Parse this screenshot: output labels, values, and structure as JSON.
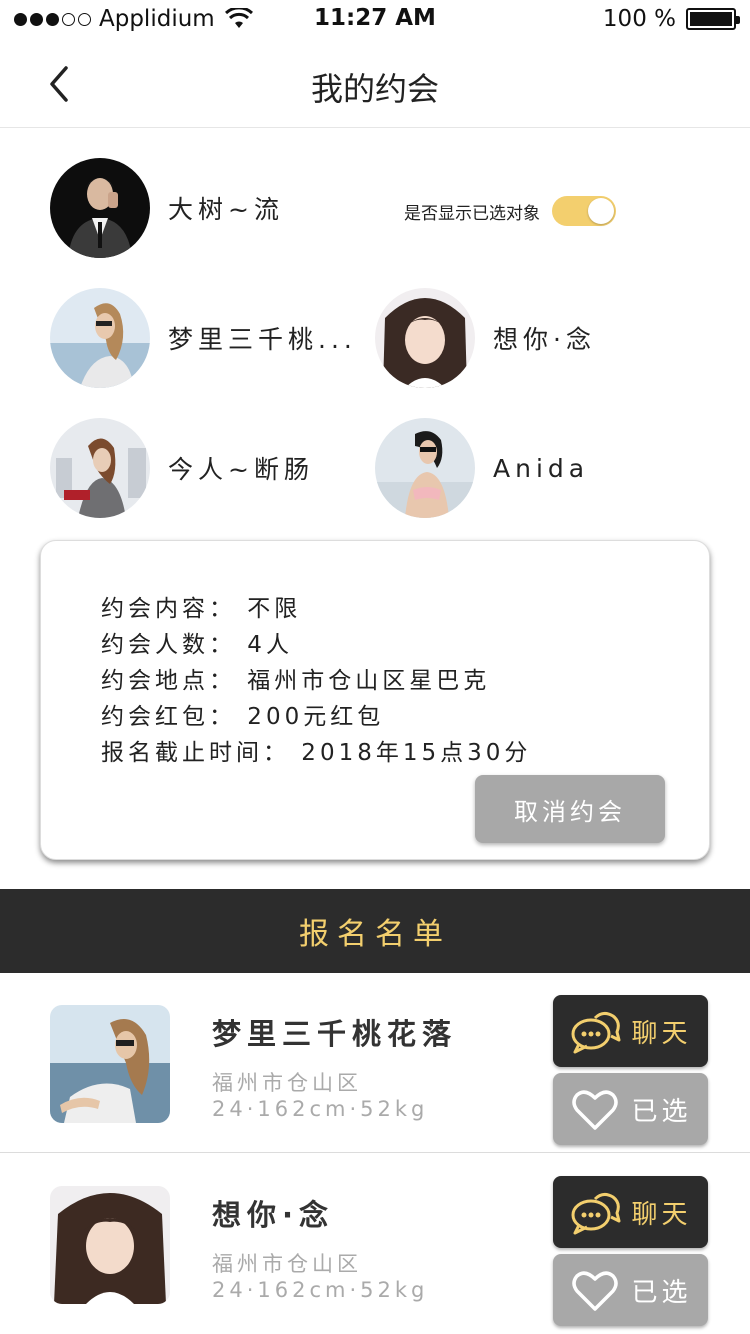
{
  "status_bar": {
    "carrier": "Applidium",
    "time": "11:27 AM",
    "battery": "100 %"
  },
  "nav": {
    "title": "我的约会",
    "back_icon": "chevron-left-icon"
  },
  "host": {
    "name": "大树~流"
  },
  "toggle": {
    "label": "是否显示已选对象",
    "on": true
  },
  "selected_people": [
    {
      "name": "梦里三千桃..."
    },
    {
      "name": "想你·念"
    },
    {
      "name": "今人~断肠"
    },
    {
      "name": "Anida"
    }
  ],
  "info": {
    "lines": [
      "约会内容：  不限",
      "约会人数：  4人",
      "约会地点：  福州市仓山区星巴克",
      "约会红包：  200元红包",
      "报名截止时间：  2018年15点30分"
    ],
    "cancel_label": "取消约会"
  },
  "section": {
    "title": "报名名单"
  },
  "applicants": [
    {
      "name": "梦里三千桃花落",
      "location": "福州市仓山区",
      "stats": "24·162cm·52kg",
      "chat_label": "聊天",
      "selected_label": "已选"
    },
    {
      "name": "想你·念",
      "location": "福州市仓山区",
      "stats": "24·162cm·52kg",
      "chat_label": "聊天",
      "selected_label": "已选"
    }
  ],
  "colors": {
    "accent": "#f3cf6e",
    "dark": "#2c2c2c",
    "gray_button": "#a8a8a8"
  }
}
